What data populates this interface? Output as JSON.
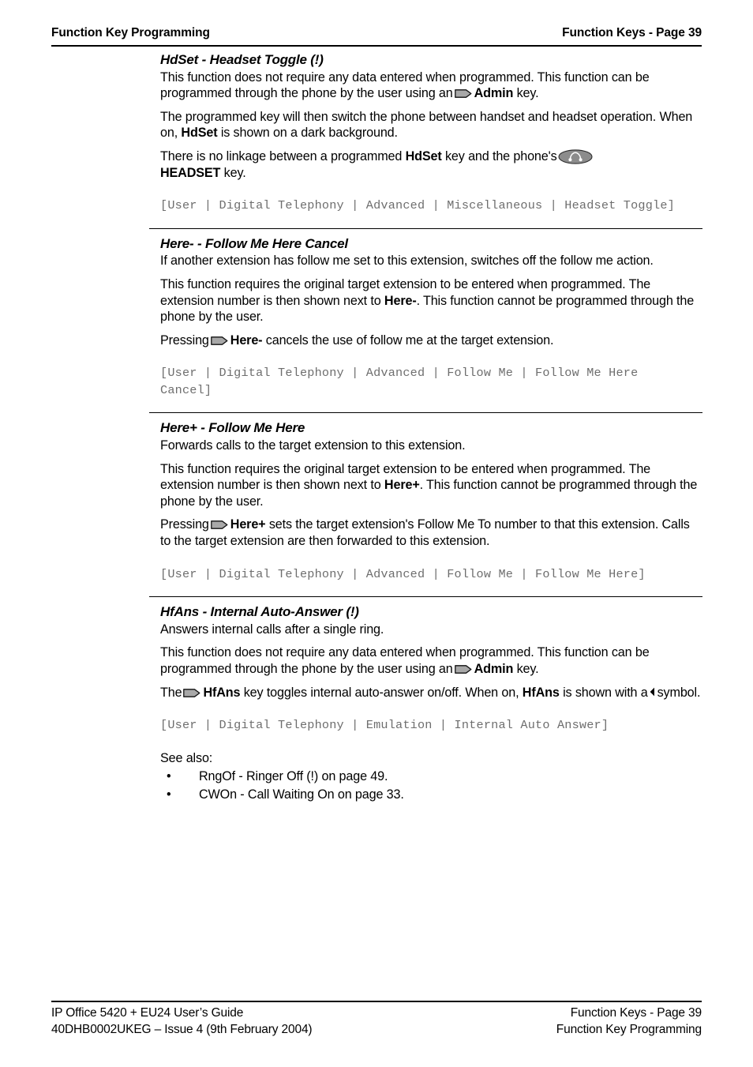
{
  "header": {
    "left": "Function Key Programming",
    "right": "Function Keys - Page 39"
  },
  "icons": {
    "key": "phone-key-icon",
    "headset": "headset-button-icon",
    "triangle": "left-triangle-icon",
    "key_fill": "#a8a8a8",
    "headset_fill": "#8c8c8c"
  },
  "sections": [
    {
      "id": "hdset",
      "title": "HdSet - Headset Toggle (!)",
      "p1_a": "This function does not require any data entered when programmed. This function can be programmed through the phone by the user using an",
      "p1_admin": "Admin",
      "p1_b": "key.",
      "p2_a": "The programmed key will then switch the phone between handset and headset operation. When on,",
      "p2_bold": "HdSet",
      "p2_b": "is shown on a dark background.",
      "p3_a": "There is no linkage between a programmed",
      "p3_bold1": "HdSet",
      "p3_b": "key and the phone's",
      "p3_bold2": "HEADSET",
      "p3_c": "key.",
      "path": "[User | Digital Telephony | Advanced | Miscellaneous | Headset Toggle]"
    },
    {
      "id": "here-minus",
      "title": "Here- - Follow Me Here Cancel",
      "p1": "If another extension has follow me set to this extension, switches off the follow me action.",
      "p2_a": "This function requires the original target extension to be entered when programmed. The extension number is then shown next to",
      "p2_bold": "Here-",
      "p2_b": ". This function cannot be programmed through the phone by the user.",
      "p3_a": "Pressing",
      "p3_bold": "Here-",
      "p3_b": "cancels the use of follow me at the target extension.",
      "path": "[User | Digital Telephony | Advanced | Follow Me | Follow Me Here\nCancel]"
    },
    {
      "id": "here-plus",
      "title": "Here+ - Follow Me Here",
      "p1": "Forwards calls to the target extension to this extension.",
      "p2_a": "This function requires the original target extension to be entered when programmed. The extension number is then shown next to",
      "p2_bold": "Here+",
      "p2_b": ". This function cannot be programmed through the phone by the user.",
      "p3_a": "Pressing",
      "p3_bold": "Here+",
      "p3_b": "sets the target extension's Follow Me To number to that this extension. Calls to the target extension are then forwarded to this extension.",
      "path": "[User | Digital Telephony | Advanced | Follow Me | Follow Me Here]"
    },
    {
      "id": "hfans",
      "title": "HfAns - Internal Auto-Answer (!)",
      "p1": "Answers internal calls after a single ring.",
      "p2_a": "This function does not require any data entered when programmed. This function can be programmed through the phone by the user using an",
      "p2_admin": "Admin",
      "p2_b": "key.",
      "p3_a": "The",
      "p3_bold1": "HfAns",
      "p3_b": "key toggles internal auto-answer on/off. When on,",
      "p3_bold2": "HfAns",
      "p3_c": "is shown with a",
      "p3_d": "symbol.",
      "path": "[User | Digital Telephony | Emulation | Internal Auto Answer]"
    }
  ],
  "see_also": {
    "heading": "See also:",
    "bullet_glyph": "•",
    "items": [
      "RngOf - Ringer Off (!) on page 49.",
      "CWOn - Call Waiting On on page 33."
    ]
  },
  "footer": {
    "left_line1": "IP Office 5420 + EU24 User’s Guide",
    "left_line2": "40DHB0002UKEG – Issue 4 (9th February 2004)",
    "right_line1": "Function Keys - Page 39",
    "right_line2": "Function Key Programming"
  }
}
